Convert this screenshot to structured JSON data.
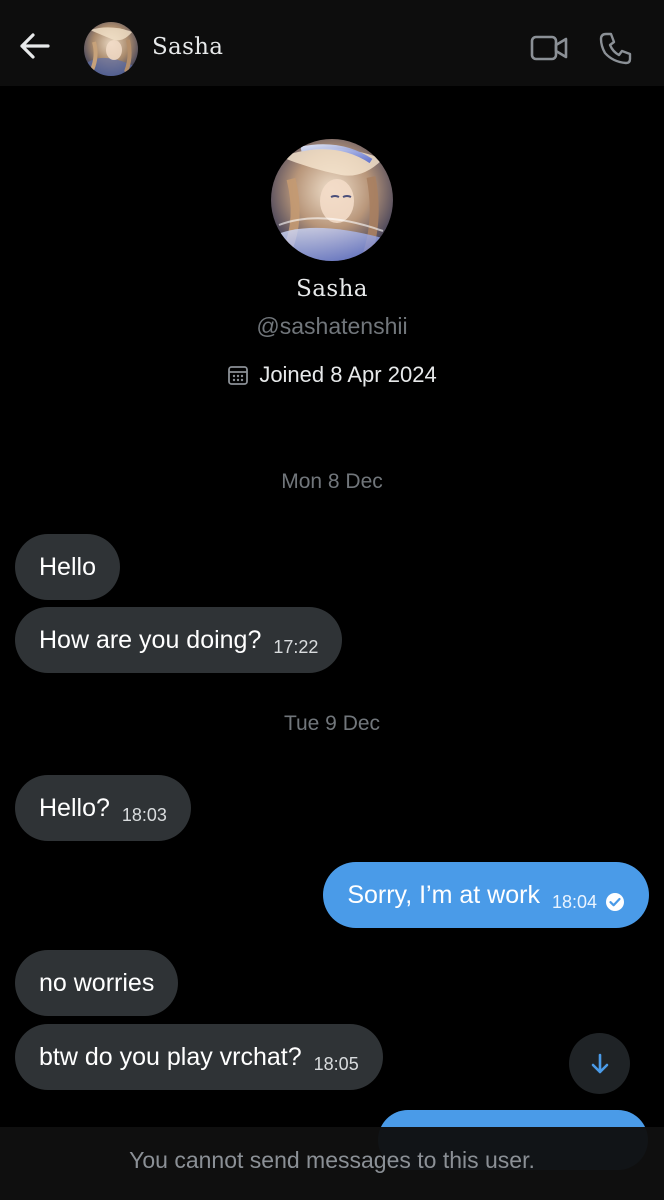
{
  "header": {
    "contact_name": "Sasha",
    "back_icon": "arrow-left-icon",
    "video_icon": "video-camera-icon",
    "call_icon": "phone-icon"
  },
  "profile": {
    "name": "Sasha",
    "handle": "@sashatenshii",
    "joined_text": "Joined 8 Apr 2024",
    "calendar_icon": "calendar-icon"
  },
  "conversation": {
    "day_1": "Mon 8 Dec",
    "day_2": "Tue 9 Dec",
    "messages": [
      {
        "direction": "in",
        "text": "Hello",
        "time": ""
      },
      {
        "direction": "in",
        "text": "How are you doing?",
        "time": "17:22"
      },
      {
        "direction": "in",
        "text": "Hello?",
        "time": "18:03"
      },
      {
        "direction": "out",
        "text": "Sorry, I’m at work",
        "time": "18:04"
      },
      {
        "direction": "in",
        "text": "no worries",
        "time": ""
      },
      {
        "direction": "in",
        "text": "btw do you play vrchat?",
        "time": "18:05"
      }
    ]
  },
  "footer": {
    "notice": "You cannot send messages to this user."
  },
  "colors": {
    "background": "#000000",
    "header_bg": "#0d0d0d",
    "incoming_bubble": "#2f3336",
    "outgoing_bubble": "#4a9be8",
    "muted_text": "#71767b",
    "accent": "#1d9bf0"
  }
}
